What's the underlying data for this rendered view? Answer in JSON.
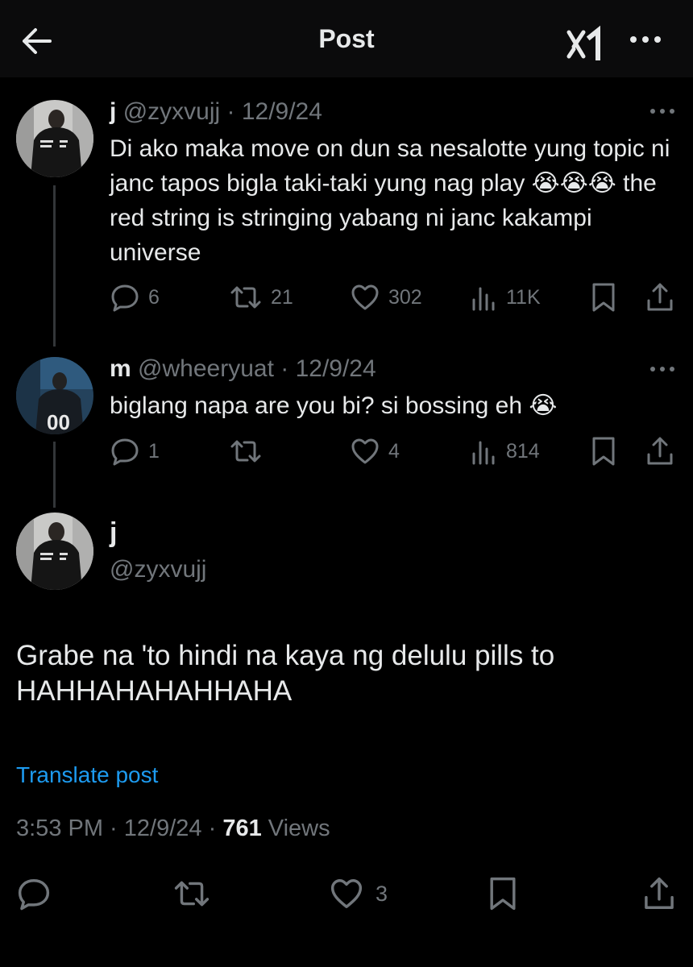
{
  "header": {
    "title": "Post",
    "back_icon": "arrow-left-icon",
    "grok_icon": "grok-icon",
    "more_icon": "more-icon"
  },
  "colors": {
    "background": "#000000",
    "text": "#e7e9ea",
    "muted": "#71767b",
    "link": "#1d9bf0"
  },
  "thread": [
    {
      "name": "j",
      "handle": "@zyxvujj",
      "date": "· 12/9/24",
      "text": "Di ako maka move on dun sa nesalotte yung topic ni janc tapos bigla taki-taki yung nag play 😭😭😭 the red string is stringing yabang ni janc kakampi universe",
      "replies": "6",
      "reposts": "21",
      "likes": "302",
      "views": "11K"
    },
    {
      "name": "m",
      "handle": "@wheeryuat",
      "date": "· 12/9/24",
      "text": "biglang napa are you bi? si bossing eh 😭",
      "replies": "1",
      "reposts": "",
      "likes": "4",
      "views": "814"
    }
  ],
  "main_post": {
    "name": "j",
    "handle": "@zyxvujj",
    "text": "Grabe na 'to hindi na kaya ng delulu pills to HAHHAHAHAHHAHA",
    "translate": "Translate post",
    "time": "3:53 PM · 12/9/24 · ",
    "views_count": "761",
    "views_label": " Views",
    "likes": "3"
  }
}
